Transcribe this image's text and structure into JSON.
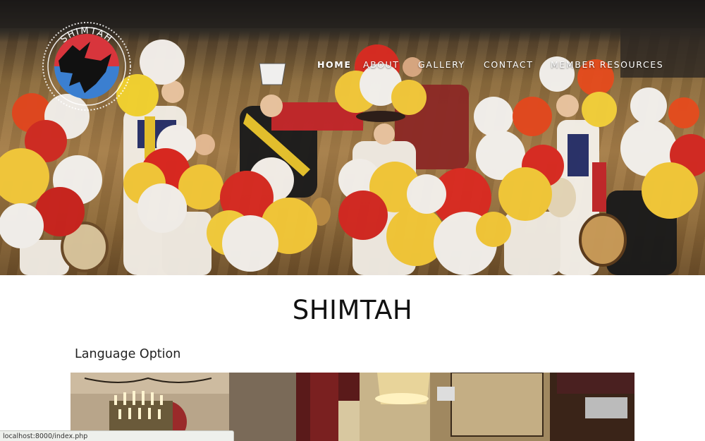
{
  "site": {
    "logo_text": "SHIMTAH",
    "title": "SHIMTAH"
  },
  "nav": {
    "items": [
      {
        "label": "HOME",
        "active": true
      },
      {
        "label": "ABOUT",
        "active": false
      },
      {
        "label": "GALLERY",
        "active": false
      },
      {
        "label": "CONTACT",
        "active": false
      },
      {
        "label": "MEMBER RESOURCES",
        "active": false
      }
    ]
  },
  "content": {
    "section_heading": "Language Option"
  },
  "status_bar": {
    "url": "localhost:8000/index.php"
  },
  "colors": {
    "logo_red": "#d8353c",
    "logo_blue": "#3b7fd0",
    "title_text": "#111111"
  }
}
